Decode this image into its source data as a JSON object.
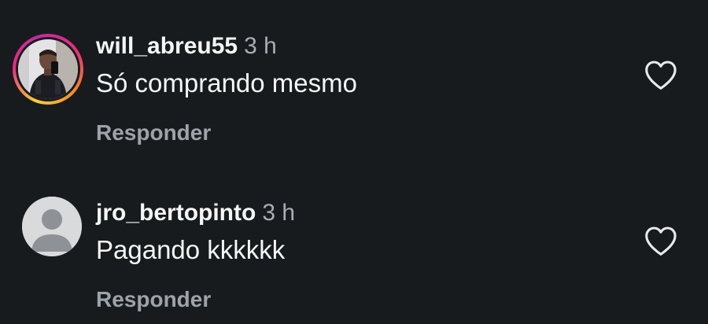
{
  "comments": [
    {
      "username": "will_abreu55",
      "time": "3 h",
      "text": "Só comprando mesmo",
      "reply_label": "Responder",
      "avatar": "profile-photo",
      "has_story_ring": true,
      "like_icon": "heart-outline-icon"
    },
    {
      "username": "jro_bertopinto",
      "time": "3 h",
      "text": "Pagando kkkkkk",
      "reply_label": "Responder",
      "avatar": "default-avatar-icon",
      "has_story_ring": false,
      "like_icon": "heart-outline-icon"
    }
  ],
  "colors": {
    "background": "#171b1e",
    "text_primary": "#f5f6f7",
    "text_secondary": "#a9aeb4",
    "reply": "#9ea3a9",
    "story_ring_start": "#f9ce34",
    "story_ring_mid": "#ee2a7b",
    "story_ring_end": "#c32aa3"
  }
}
